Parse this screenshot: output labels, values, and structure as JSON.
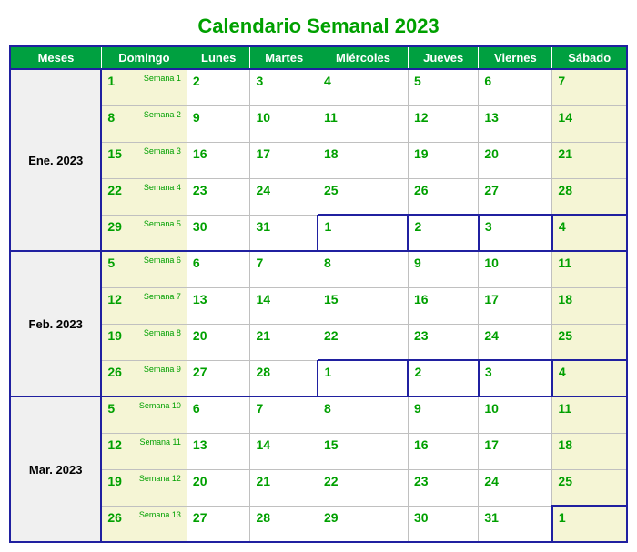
{
  "title": "Calendario Semanal 2023",
  "header": {
    "meses": "Meses",
    "days": [
      "Domingo",
      "Lunes",
      "Martes",
      "Miércoles",
      "Jueves",
      "Viernes",
      "Sábado"
    ]
  },
  "months": [
    {
      "label": "Ene. 2023",
      "rowspan": 5,
      "weeks": [
        {
          "sun": 1,
          "tag": "Semana 1",
          "days": [
            2,
            3,
            4,
            5,
            6,
            7
          ],
          "next_start": null
        },
        {
          "sun": 8,
          "tag": "Semana 2",
          "days": [
            9,
            10,
            11,
            12,
            13,
            14
          ],
          "next_start": null
        },
        {
          "sun": 15,
          "tag": "Semana 3",
          "days": [
            16,
            17,
            18,
            19,
            20,
            21
          ],
          "next_start": null
        },
        {
          "sun": 22,
          "tag": "Semana 4",
          "days": [
            23,
            24,
            25,
            26,
            27,
            28
          ],
          "next_start": null
        },
        {
          "sun": 29,
          "tag": "Semana 5",
          "days": [
            30,
            31,
            1,
            2,
            3,
            4
          ],
          "next_start": 2
        }
      ]
    },
    {
      "label": "Feb. 2023",
      "rowspan": 4,
      "weeks": [
        {
          "sun": 5,
          "tag": "Semana 6",
          "days": [
            6,
            7,
            8,
            9,
            10,
            11
          ],
          "next_start": null
        },
        {
          "sun": 12,
          "tag": "Semana 7",
          "days": [
            13,
            14,
            15,
            16,
            17,
            18
          ],
          "next_start": null
        },
        {
          "sun": 19,
          "tag": "Semana 8",
          "days": [
            20,
            21,
            22,
            23,
            24,
            25
          ],
          "next_start": null
        },
        {
          "sun": 26,
          "tag": "Semana 9",
          "days": [
            27,
            28,
            1,
            2,
            3,
            4
          ],
          "next_start": 2
        }
      ]
    },
    {
      "label": "Mar. 2023",
      "rowspan": 4,
      "weeks": [
        {
          "sun": 5,
          "tag": "Semana 10",
          "days": [
            6,
            7,
            8,
            9,
            10,
            11
          ],
          "next_start": null
        },
        {
          "sun": 12,
          "tag": "Semana 11",
          "days": [
            13,
            14,
            15,
            16,
            17,
            18
          ],
          "next_start": null
        },
        {
          "sun": 19,
          "tag": "Semana 12",
          "days": [
            20,
            21,
            22,
            23,
            24,
            25
          ],
          "next_start": null
        },
        {
          "sun": 26,
          "tag": "Semana 13",
          "days": [
            27,
            28,
            29,
            30,
            31,
            1
          ],
          "next_start": 5
        }
      ]
    }
  ]
}
